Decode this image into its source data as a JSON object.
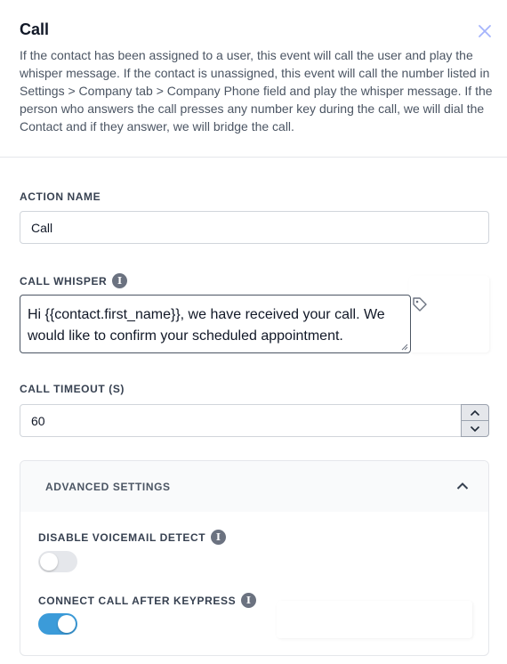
{
  "header": {
    "title": "Call",
    "description": "If the contact has been assigned to a user, this event will call the user and play the whisper message. If the contact is unassigned, this event will call the number listed in Settings > Company tab > Company Phone field and play the whisper message. If the person who answers the call presses any number key during the call, we will dial the Contact and if they answer, we will bridge the call."
  },
  "icons": {
    "close": "close-icon",
    "info": "info-icon",
    "tag": "tag-icon",
    "chevron_up": "chevron-up-icon",
    "chevron_down": "chevron-down-icon"
  },
  "action_name": {
    "label": "ACTION NAME",
    "value": "Call"
  },
  "call_whisper": {
    "label": "CALL WHISPER",
    "value": "Hi {{contact.first_name}}, we have received your call. We would like to confirm your scheduled appointment."
  },
  "call_timeout": {
    "label": "CALL TIMEOUT (S)",
    "value": "60"
  },
  "advanced": {
    "title": "ADVANCED SETTINGS",
    "expanded": true,
    "disable_voicemail": {
      "label": "DISABLE VOICEMAIL DETECT",
      "enabled": false
    },
    "connect_after_keypress": {
      "label": "CONNECT CALL AFTER KEYPRESS",
      "enabled": true
    }
  },
  "colors": {
    "toggle_on": "#3b9bd9",
    "toggle_off": "#e5e7eb",
    "border": "#d1d5db",
    "text_muted": "#4b5563"
  }
}
